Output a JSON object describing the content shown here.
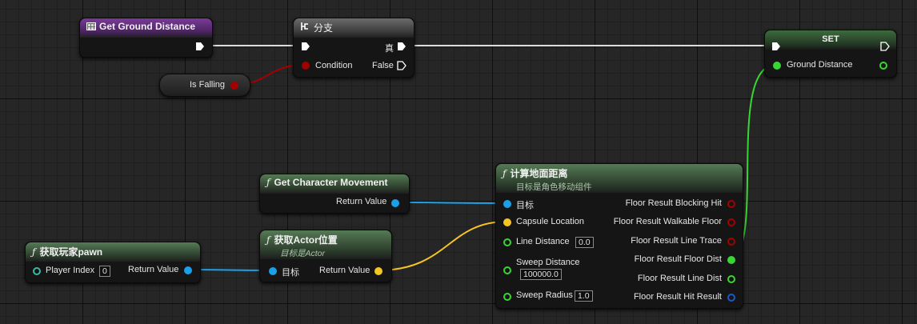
{
  "colors": {
    "exec": "#ffffff",
    "bool": "#a50000",
    "float": "#39d633",
    "object": "#1aa0e8",
    "vector": "#f5c523",
    "struct": "#1c5ac9"
  },
  "icons": {
    "function": "function-icon",
    "branch": "branch-icon",
    "struct": "struct-icon"
  },
  "nodes": {
    "get_ground_distance": {
      "title": "Get Ground Distance"
    },
    "branch": {
      "title": "分支",
      "condition": "Condition",
      "true_label": "真",
      "false_label": "False"
    },
    "is_falling": {
      "label": "Is Falling"
    },
    "set": {
      "title": "SET",
      "ground_distance": "Ground Distance"
    },
    "get_character_movement": {
      "title": "Get Character Movement",
      "return_value": "Return Value"
    },
    "get_player_pawn": {
      "title": "获取玩家pawn",
      "player_index": "Player Index",
      "player_index_value": "0",
      "return_value": "Return Value"
    },
    "get_actor_location": {
      "title": "获取Actor位置",
      "subtitle": "目标是Actor",
      "target": "目标",
      "return_value": "Return Value"
    },
    "compute_floor_dist": {
      "title": "计算地面距离",
      "subtitle": "目标是角色移动组件",
      "inputs": {
        "target": "目标",
        "capsule_location": "Capsule Location",
        "line_distance": "Line Distance",
        "line_distance_value": "0.0",
        "sweep_distance": "Sweep Distance",
        "sweep_distance_value": "100000.0",
        "sweep_radius": "Sweep Radius",
        "sweep_radius_value": "1.0"
      },
      "outputs": {
        "blocking_hit": "Floor Result Blocking Hit",
        "walkable_floor": "Floor Result Walkable Floor",
        "line_trace": "Floor Result Line Trace",
        "floor_dist": "Floor Result Floor Dist",
        "line_dist": "Floor Result Line Dist",
        "hit_result": "Floor Result Hit Result"
      }
    }
  }
}
